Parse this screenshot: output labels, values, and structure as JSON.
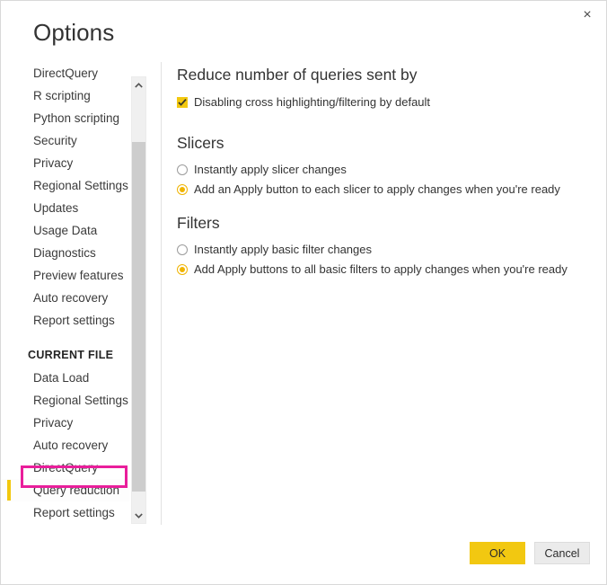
{
  "dialog": {
    "title": "Options",
    "close_label": "×"
  },
  "sidebar": {
    "global_items": [
      {
        "label": "DirectQuery"
      },
      {
        "label": "R scripting"
      },
      {
        "label": "Python scripting"
      },
      {
        "label": "Security"
      },
      {
        "label": "Privacy"
      },
      {
        "label": "Regional Settings"
      },
      {
        "label": "Updates"
      },
      {
        "label": "Usage Data"
      },
      {
        "label": "Diagnostics"
      },
      {
        "label": "Preview features"
      },
      {
        "label": "Auto recovery"
      },
      {
        "label": "Report settings"
      }
    ],
    "section_header": "CURRENT FILE",
    "current_file_items": [
      {
        "label": "Data Load"
      },
      {
        "label": "Regional Settings"
      },
      {
        "label": "Privacy"
      },
      {
        "label": "Auto recovery"
      },
      {
        "label": "DirectQuery"
      },
      {
        "label": "Query reduction"
      },
      {
        "label": "Report settings"
      }
    ],
    "selected_label": "Query reduction",
    "annotation_color": "#e91e9b",
    "accent_color": "#f2c80f"
  },
  "scrollbar": {
    "up_arrow": "chevron-up",
    "down_arrow": "chevron-down"
  },
  "content": {
    "section_reduce": {
      "heading": "Reduce number of queries sent by",
      "checkbox": {
        "label": "Disabling cross highlighting/filtering by default",
        "checked": true
      }
    },
    "section_slicers": {
      "heading": "Slicers",
      "options": [
        {
          "label": "Instantly apply slicer changes",
          "selected": false
        },
        {
          "label": "Add an Apply button to each slicer to apply changes when you're ready",
          "selected": true
        }
      ]
    },
    "section_filters": {
      "heading": "Filters",
      "options": [
        {
          "label": "Instantly apply basic filter changes",
          "selected": false
        },
        {
          "label": "Add Apply buttons to all basic filters to apply changes when you're ready",
          "selected": true
        }
      ]
    }
  },
  "footer": {
    "ok_label": "OK",
    "cancel_label": "Cancel"
  }
}
